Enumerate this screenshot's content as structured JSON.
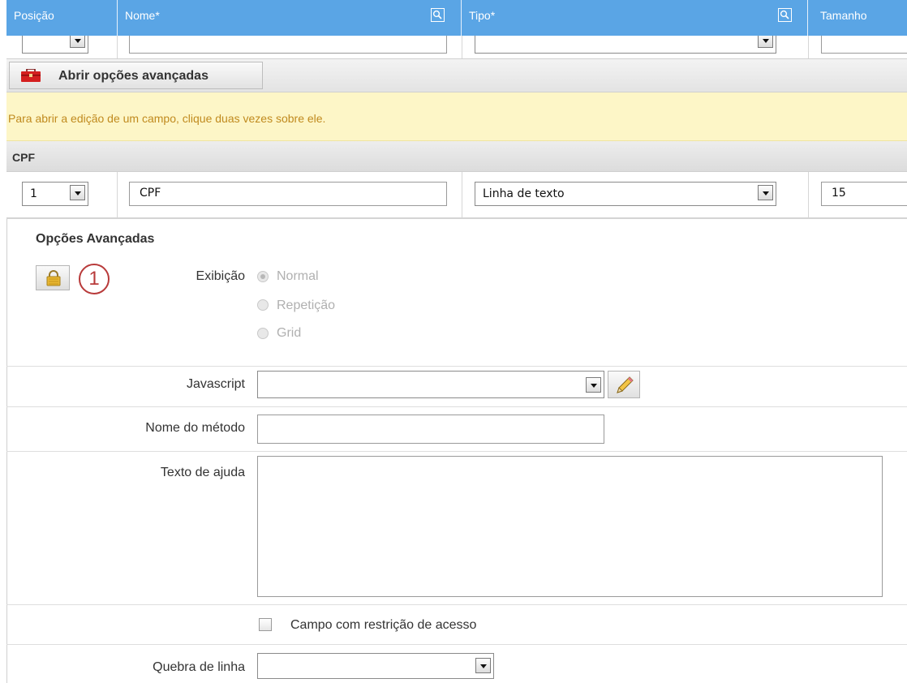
{
  "header": {
    "col_position": "Posição",
    "col_name": "Nome*",
    "col_type": "Tipo*",
    "col_size": "Tamanho"
  },
  "advanced_button": {
    "label": "Abrir opções avançadas"
  },
  "notice": {
    "text": "Para abrir a edição de um campo, clique duas vezes sobre ele."
  },
  "field": {
    "section_title": "CPF",
    "position": "1",
    "name": "CPF",
    "type": "Linha de texto",
    "size": "15"
  },
  "advanced": {
    "title": "Opções Avançadas",
    "step_number": "1",
    "display_label": "Exibição",
    "display_options": [
      "Normal",
      "Repetição",
      "Grid"
    ],
    "display_selected": "Normal",
    "javascript_label": "Javascript",
    "javascript_value": "",
    "method_label": "Nome do método",
    "method_value": "",
    "help_label": "Texto de ajuda",
    "help_value": "",
    "restricted_label": "Campo com restrição de acesso",
    "restricted_checked": false,
    "linebreak_label": "Quebra de linha",
    "linebreak_value": ""
  },
  "colors": {
    "header_blue": "#5aa5e5",
    "notice_yellow": "#fdf6c7",
    "notice_text": "#c08a1e",
    "step_badge": "#b83a3a"
  }
}
